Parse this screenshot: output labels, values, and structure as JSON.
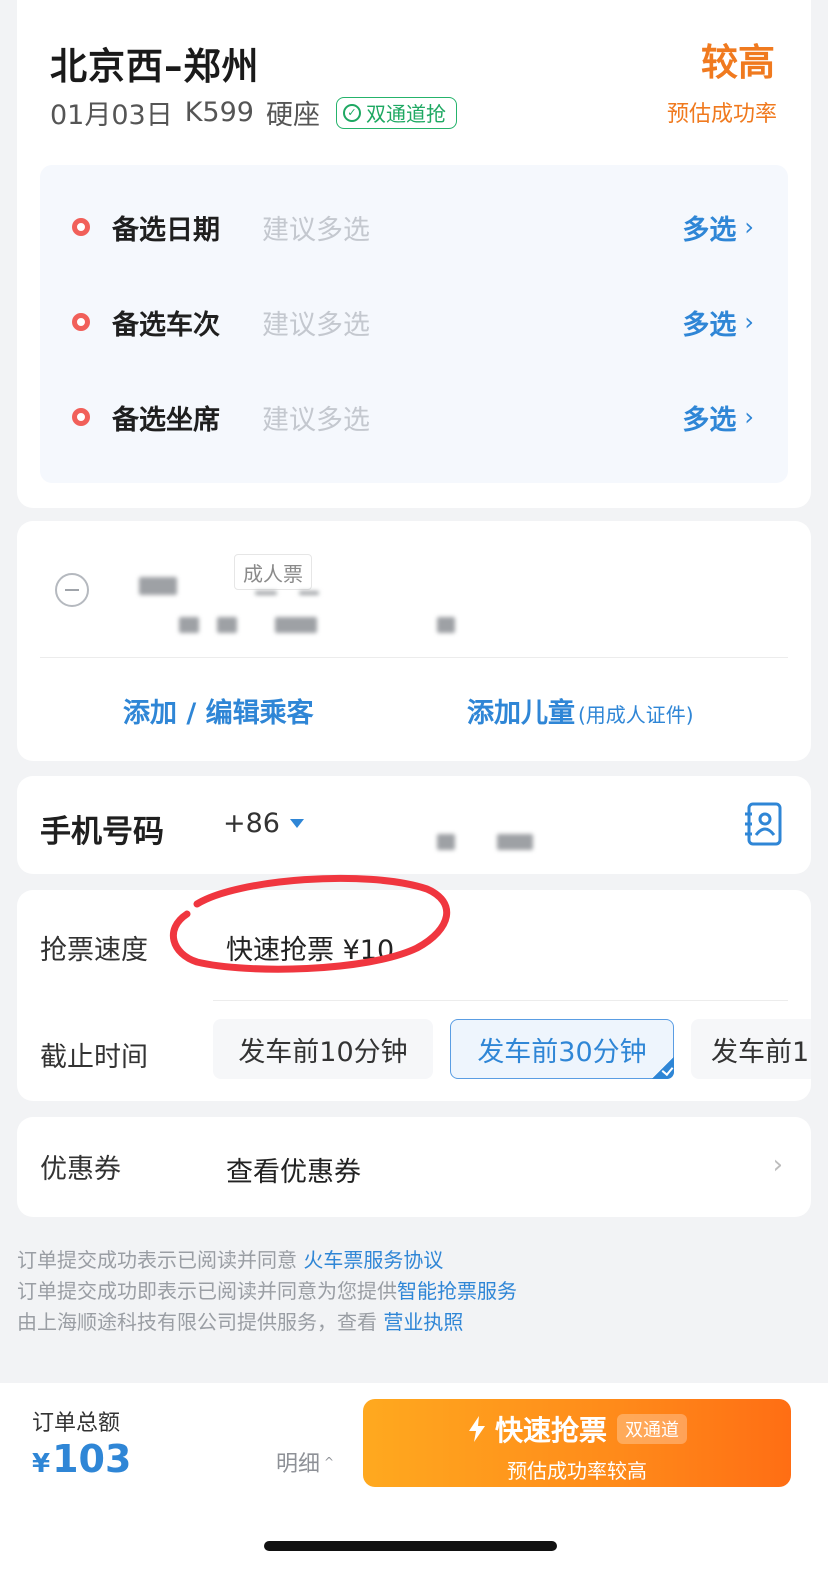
{
  "trip": {
    "route": "北京西–郑州",
    "date": "01月03日",
    "train": "K599",
    "seat": "硬座",
    "dual_badge": "双通道抢",
    "success_rate_value": "较高",
    "success_rate_label": "预估成功率"
  },
  "alternatives": {
    "items": [
      {
        "label": "备选日期",
        "hint": "建议多选",
        "action": "多选"
      },
      {
        "label": "备选车次",
        "hint": "建议多选",
        "action": "多选"
      },
      {
        "label": "备选坐席",
        "hint": "建议多选",
        "action": "多选"
      }
    ]
  },
  "passenger": {
    "ticket_type": "成人票",
    "add_edit": "添加 / 编辑乘客",
    "add_child": "添加儿童",
    "add_child_note": "(用成人证件)"
  },
  "phone": {
    "label": "手机号码",
    "country_code": "+86"
  },
  "speed": {
    "label": "抢票速度",
    "value": "快速抢票 ¥10",
    "annotation_color": "#f0363f"
  },
  "deadline": {
    "label": "截止时间",
    "options": [
      "发车前10分钟",
      "发车前30分钟",
      "发车前1"
    ],
    "selected": "发车前30分钟"
  },
  "coupon": {
    "label": "优惠券",
    "value": "查看优惠券"
  },
  "agreement": {
    "line1_text": "订单提交成功表示已阅读并同意 ",
    "line1_link": "火车票服务协议",
    "line2_text": "订单提交成功即表示已阅读并同意为您提供",
    "line2_link": "智能抢票服务",
    "line3_text": "由上海顺途科技有限公司提供服务，查看 ",
    "line3_link": "营业执照"
  },
  "bottom": {
    "total_label": "订单总额",
    "currency": "¥",
    "total": "103",
    "detail": "明细",
    "buy_label": "快速抢票",
    "buy_badge": "双通道",
    "buy_sub": "预估成功率较高"
  },
  "colors": {
    "accent_blue": "#2f86d6",
    "accent_orange": "#f07a1f",
    "dot_red": "#f1605a",
    "badge_green": "#1ea862"
  }
}
